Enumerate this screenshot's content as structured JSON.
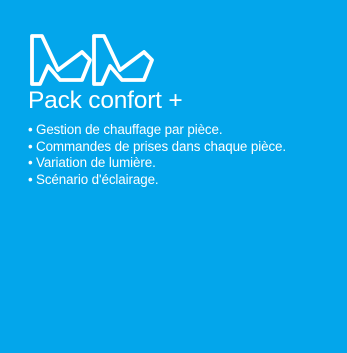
{
  "panel": {
    "background_color": "#03a6eb",
    "text_color": "#ffffff",
    "logo_icon": "double-armchair-icon",
    "title": "Pack confort +",
    "bullet": "•",
    "features": [
      "Gestion de chauffage par pièce.",
      "Commandes de prises dans chaque pièce.",
      "Variation de lumière.",
      "Scénario d'éclairage."
    ]
  }
}
